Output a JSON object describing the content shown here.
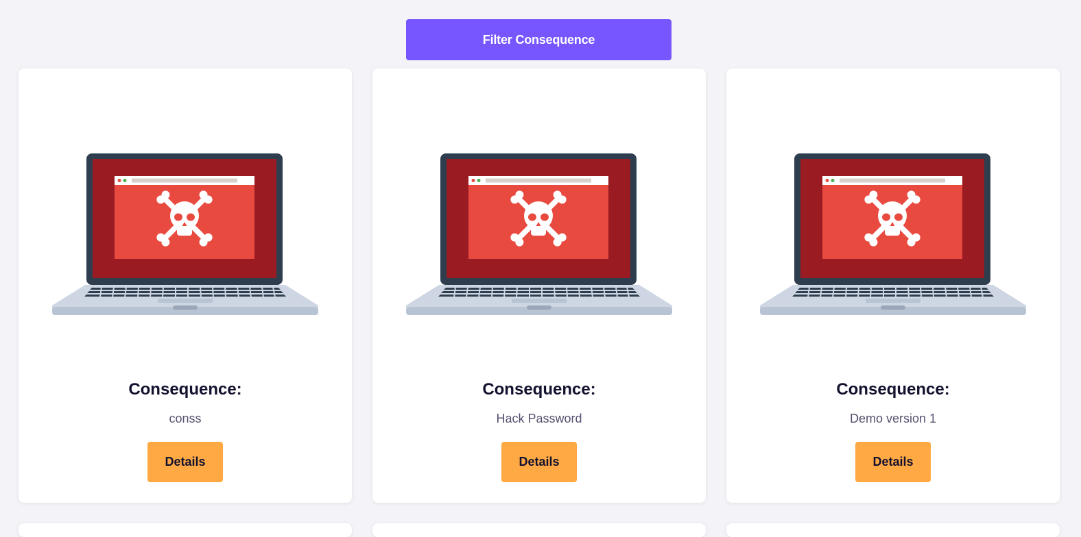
{
  "header": {
    "filter_button_label": "Filter Consequence"
  },
  "cards": [
    {
      "title": "Consequence:",
      "description": "conss",
      "button_label": "Details",
      "image": "laptop-skull-icon"
    },
    {
      "title": "Consequence:",
      "description": "Hack Password",
      "button_label": "Details",
      "image": "laptop-skull-icon"
    },
    {
      "title": "Consequence:",
      "description": "Demo version 1",
      "button_label": "Details",
      "image": "laptop-skull-icon"
    }
  ],
  "colors": {
    "accent": "#7856ff",
    "details_button": "#ffa944",
    "title_text": "#12112e",
    "page_background": "#f3f3f8"
  }
}
